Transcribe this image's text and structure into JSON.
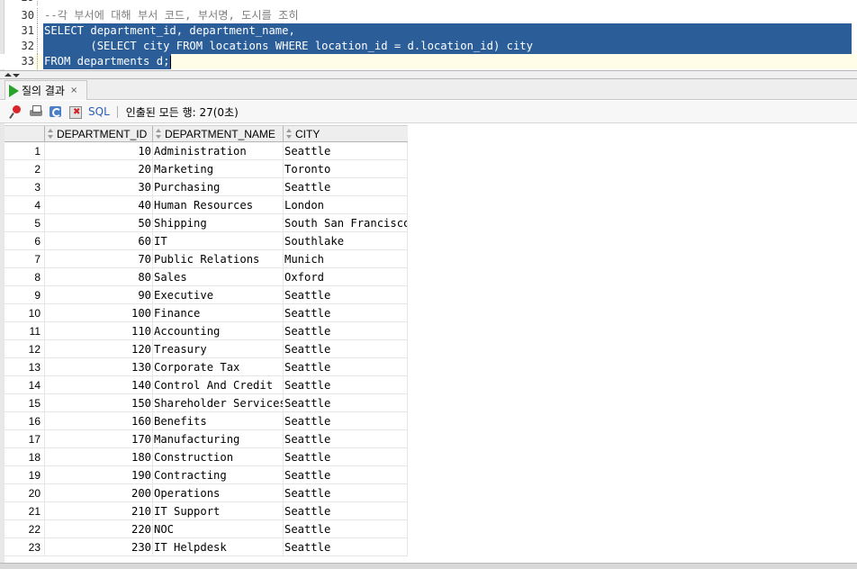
{
  "editor": {
    "lines": [
      {
        "number": "29",
        "text": ""
      },
      {
        "number": "30",
        "text": "--각 부서에 대해 부서 코드, 부서명, 도시를 조히"
      },
      {
        "number": "31",
        "text": "SELECT department_id, department_name,"
      },
      {
        "number": "32",
        "text": "       (SELECT city FROM locations WHERE location_id = d.location_id) city"
      },
      {
        "number": "33",
        "text": "FROM departments d;"
      }
    ]
  },
  "results_tab": {
    "label": "질의 결과",
    "close": "×"
  },
  "toolbar": {
    "sql_label": "SQL",
    "status": "인출된 모든 행: 27(0초)"
  },
  "grid": {
    "columns": [
      "DEPARTMENT_ID",
      "DEPARTMENT_NAME",
      "CITY"
    ],
    "rows": [
      [
        "1",
        "10",
        "Administration",
        "Seattle"
      ],
      [
        "2",
        "20",
        "Marketing",
        "Toronto"
      ],
      [
        "3",
        "30",
        "Purchasing",
        "Seattle"
      ],
      [
        "4",
        "40",
        "Human Resources",
        "London"
      ],
      [
        "5",
        "50",
        "Shipping",
        "South San Francisco"
      ],
      [
        "6",
        "60",
        "IT",
        "Southlake"
      ],
      [
        "7",
        "70",
        "Public Relations",
        "Munich"
      ],
      [
        "8",
        "80",
        "Sales",
        "Oxford"
      ],
      [
        "9",
        "90",
        "Executive",
        "Seattle"
      ],
      [
        "10",
        "100",
        "Finance",
        "Seattle"
      ],
      [
        "11",
        "110",
        "Accounting",
        "Seattle"
      ],
      [
        "12",
        "120",
        "Treasury",
        "Seattle"
      ],
      [
        "13",
        "130",
        "Corporate Tax",
        "Seattle"
      ],
      [
        "14",
        "140",
        "Control And Credit",
        "Seattle"
      ],
      [
        "15",
        "150",
        "Shareholder Services",
        "Seattle"
      ],
      [
        "16",
        "160",
        "Benefits",
        "Seattle"
      ],
      [
        "17",
        "170",
        "Manufacturing",
        "Seattle"
      ],
      [
        "18",
        "180",
        "Construction",
        "Seattle"
      ],
      [
        "19",
        "190",
        "Contracting",
        "Seattle"
      ],
      [
        "20",
        "200",
        "Operations",
        "Seattle"
      ],
      [
        "21",
        "210",
        "IT Support",
        "Seattle"
      ],
      [
        "22",
        "220",
        "NOC",
        "Seattle"
      ],
      [
        "23",
        "230",
        "IT Helpdesk",
        "Seattle"
      ]
    ]
  },
  "colors": {
    "selection": "#2b5e99",
    "comment": "#808080",
    "run_icon": "#2aa12a",
    "sql_link": "#2b5fb5"
  },
  "icons": [
    "pin-icon",
    "print-icon",
    "refresh-icon",
    "cancel-icon",
    "play-icon",
    "sort-icon"
  ]
}
